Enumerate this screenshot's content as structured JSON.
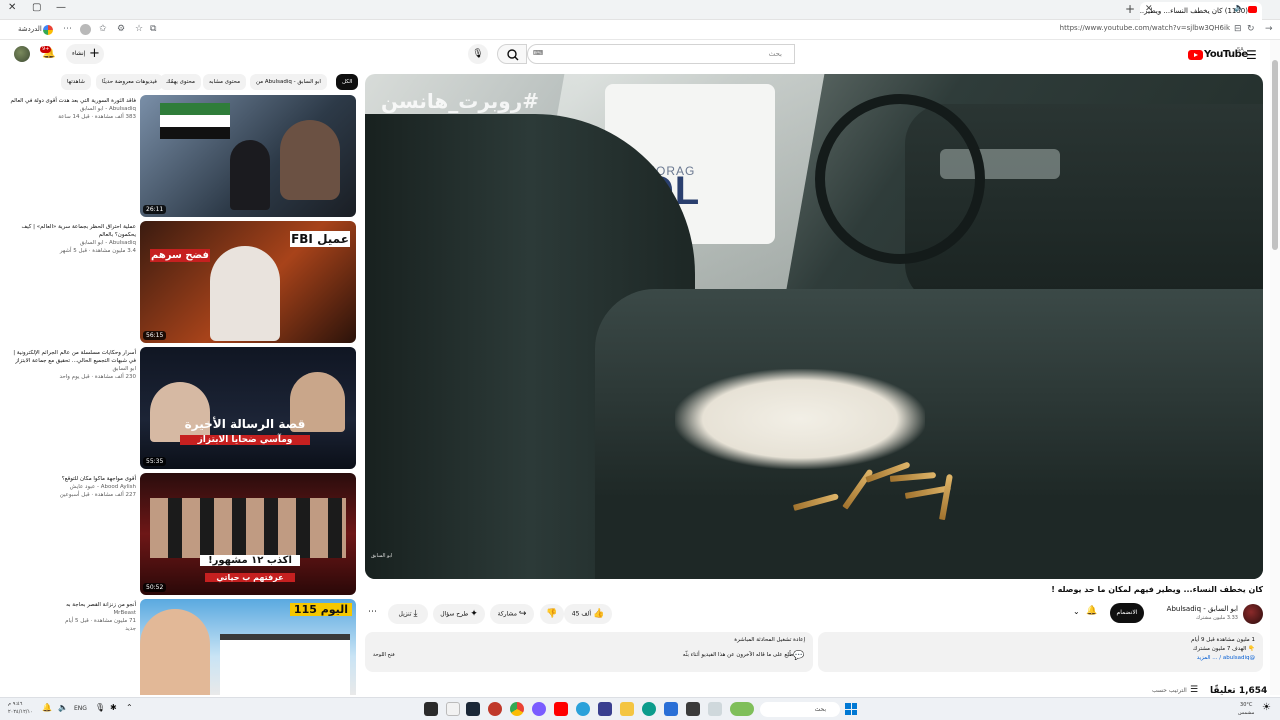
{
  "browser": {
    "tab_title": "(1150) كان يخطف النساء... ويطير...",
    "url": "https://www.youtube.com/watch?v=sjlbw3QH6ik",
    "extension_label": "الدردشة"
  },
  "header": {
    "logo_text": "YouTube",
    "logo_region": "SA",
    "search_placeholder": "بحث",
    "create_label": "إنشاء",
    "notification_count": "9+"
  },
  "player": {
    "overlay_tag": "#روبرت_هانسن",
    "police_text": "POL",
    "anchorage_text": "ANCHORAG",
    "watermark": "ابو السابق"
  },
  "video": {
    "title": "كان يخطف النساء... ويطير فيهم لمكان ما حد يوصله !",
    "channel": "ابو السابق - Abulsadiq",
    "subscribers": "3.33 مليون مشترك",
    "join_label": "الانضمام",
    "likes": "45 ألف",
    "share_label": "مشاركة",
    "ask_label": "طرح سؤال",
    "download_label": "تنزيل"
  },
  "description": {
    "line1": "1 مليون مشاهدة  قبل 9 أيام",
    "line2": "👇 الهدف 7 مليون مشترك",
    "line3": "@abulsadiq / ... المزيد"
  },
  "live_chat": {
    "line1": "إعادة تشغيل المحادثة المباشرة",
    "line2": "اطّلِع على ما قاله الآخرون عن هذا الفيديو أثناء بثّه",
    "button": "فتح اللوحة"
  },
  "comments": {
    "count": "1,654 تعليقًا",
    "sort_label": "الترتيب حسب"
  },
  "chips": [
    "الكل",
    "من Abulsadiq - ابو السابق",
    "محتوى مشابه",
    "محتوى يهمّك",
    "فيديوهات معروضة حديثًا",
    "شاهدتها"
  ],
  "recommendations": [
    {
      "title": "فاقد الثورة السورية التي بعد هدت أقوى دولة في العالم",
      "channel": "Abulsadiq - ابو السابق",
      "meta": "383 ألف مشاهدة · قبل 14 ساعة",
      "duration": "26:11"
    },
    {
      "title": "عملية احتراق الحظر بجماعة سرية «العالم» | كيف يحكمون؟ بالعالم",
      "channel": "Abulsadiq - ابو السابق",
      "meta": "3.4 مليون مشاهدة · قبل 5 أشهر",
      "duration": "56:15",
      "thumb_text1": "عميل FBI",
      "thumb_text2": "فضح سرهم"
    },
    {
      "title": "أسرار وحكايات مسلسلة من عالم الجرائم الإلكترونية | في شبهات التجميع الحالي... تحقيق مع جماعة الابتزاز",
      "channel": "ابو السابق",
      "meta": "230 ألف مشاهدة · قبل يوم واحد",
      "duration": "55:35",
      "thumb_text1": "قصة الرسالة الأخيرة",
      "thumb_text2": "ومآسي ضحايا الابتزاز"
    },
    {
      "title": "أقوى مواجهة ماكوا مكان للتوقع؟",
      "channel": "Abood Aylish - عبود عايش",
      "meta": "227 ألف مشاهدة · قبل أسبوعين",
      "duration": "50:52",
      "thumb_text1": "اكذب ١٢ مشهور!",
      "thumb_text2": "عرفتهم ب حياتي"
    },
    {
      "title": "أنجو من زنزانة القصر بحاجة به",
      "channel": "MrBeast",
      "meta": "71 مليون مشاهدة · قبل 5 أيام",
      "duration": "",
      "badge": "جديد",
      "thumb_text1": "اليوم 115"
    }
  ],
  "taskbar": {
    "search_label": "بحث",
    "lang": "ENG",
    "clock_time": "٩:٤٦ م",
    "clock_date": "٢٠٢٤/١٢/١٠",
    "weather_temp": "30°C",
    "weather_desc": "مشمس"
  },
  "colors": {
    "brand_red": "#ff0000",
    "text_primary": "#0f0f0f",
    "text_secondary": "#606060",
    "chip_bg": "#f2f2f2"
  }
}
